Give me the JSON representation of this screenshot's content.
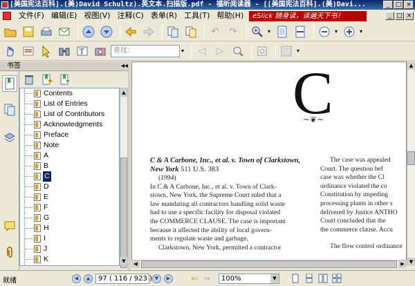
{
  "window": {
    "title": "[美国宪法百科].(美)David Schultz).英文本.扫描版.pdf - 福昕阅读器 - [[美国宪法百科].(美)Davi...",
    "controls": [
      "_",
      "□",
      "×"
    ]
  },
  "menu": {
    "items": [
      "文件(F)",
      "编辑(E)",
      "视图(V)",
      "注释(C)",
      "表单(R)",
      "工具(T)",
      "帮助(H)"
    ],
    "ad_text": "eSlick 随身读，读遍天下书！"
  },
  "toolbar1": {
    "icons": [
      "open-icon",
      "save-icon",
      "print-icon",
      "email-icon",
      "page-up-icon",
      "page-down-icon",
      "back-icon",
      "forward-icon",
      "extract-icon",
      "insert-icon",
      "undo-icon",
      "redo-icon",
      "zoom-in-icon",
      "fit-page-icon",
      "fit-width-icon",
      "zoom-out-minus-icon",
      "zoom-in-plus-icon"
    ]
  },
  "toolbar2": {
    "find_placeholder": "查找：",
    "icons": [
      "hand-tool-icon",
      "select-text-icon",
      "select-arrow-icon",
      "binoculars-icon",
      "text-select-icon",
      "snapshot-icon"
    ]
  },
  "sidebar": {
    "header": "书签",
    "collapse_label": "◂◂",
    "bookmarks": [
      {
        "label": "Contents",
        "selected": false
      },
      {
        "label": "List of Entries",
        "selected": false
      },
      {
        "label": "List of Contributors",
        "selected": false
      },
      {
        "label": "Acknowledgments",
        "selected": false
      },
      {
        "label": "Preface",
        "selected": false
      },
      {
        "label": "Note",
        "selected": false
      },
      {
        "label": "A",
        "selected": false
      },
      {
        "label": "B",
        "selected": false
      },
      {
        "label": "C",
        "selected": true
      },
      {
        "label": "D",
        "selected": false
      },
      {
        "label": "E",
        "selected": false
      },
      {
        "label": "F",
        "selected": false
      },
      {
        "label": "G",
        "selected": false
      },
      {
        "label": "H",
        "selected": false
      },
      {
        "label": "I",
        "selected": false
      },
      {
        "label": "J",
        "selected": false
      },
      {
        "label": "K",
        "selected": false
      }
    ]
  },
  "document": {
    "chapter_letter": "C",
    "ornament": "~❦~",
    "entry_title": "C & A Carbone, Inc., et al. v. Town of Clarkstown, New York",
    "entry_cite": "511 U.S. 383",
    "entry_year": "(1994)",
    "col1_lines": [
      "In C & A Carbone, Inc., et al. v. Town of Clark-",
      "stown, New York, the Supreme Court ruled that a",
      "law mandating all contractors handling solid waste",
      "had to use a specific facility for disposal violated",
      "the COMMERCE CLAUSE. The case is important",
      "because it affected the ability of local govern-",
      "ments to regulate waste and garbage."
    ],
    "col1_para2": "Clarkstown, New York, permitted a contractor",
    "col2_lines": [
      "The case was appealed",
      "Court. The question bef",
      "case was whether the Cl",
      "ordinance violated the co",
      "Constitution by impeding",
      "processing plants in other s",
      "delivered by Justice ANTHO",
      "Court concluded that the",
      "the commerce clause. Accu"
    ],
    "col2_para2": "The flow control ordinance"
  },
  "status": {
    "text": "就绪",
    "page_display": "97  ( 116 / 923 )",
    "zoom": "100%"
  }
}
